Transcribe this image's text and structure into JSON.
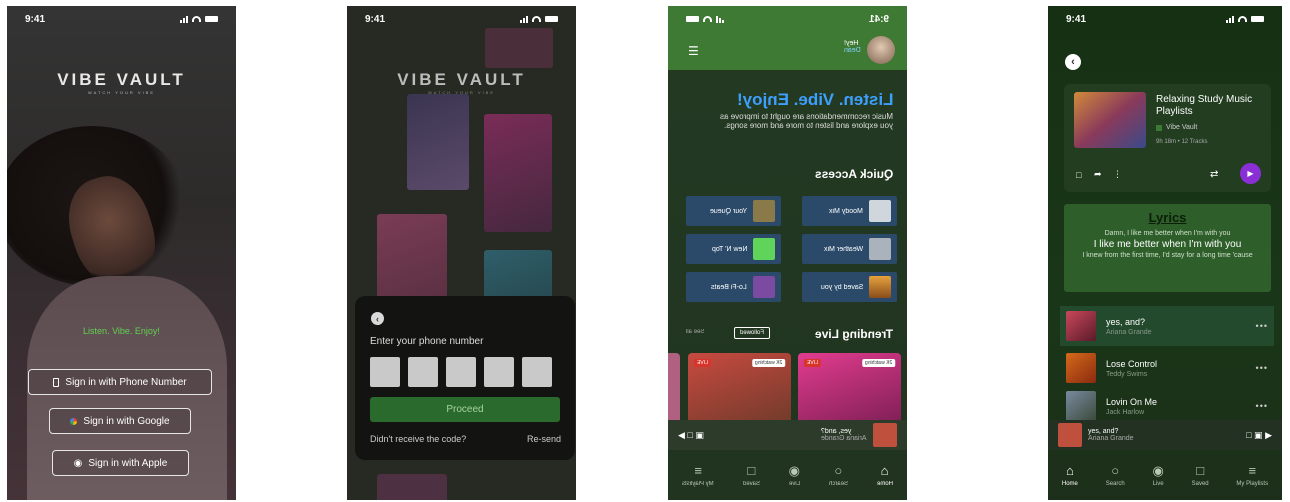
{
  "status": {
    "time": "9:41"
  },
  "screen1": {
    "brand": "VIBE VAULT",
    "brand_sub": "WATCH YOUR VIBE",
    "tagline": "Listen. Vibe. Enjoy!",
    "phone_btn": "Sign in with Phone Number",
    "google_btn": "Sign in with Google",
    "apple_btn": "Sign in with Apple"
  },
  "screen2": {
    "brand": "VIBE VAULT",
    "brand_sub": "WATCH YOUR VIBE",
    "prompt": "Enter your phone number",
    "proceed": "Proceed",
    "no_code": "Didn't receive the code?",
    "resend": "Re-send"
  },
  "screen3": {
    "status_time": "9:41",
    "greeting": "Hey!",
    "user": "Dean",
    "headline": "Listen. Vibe. Enjoy!",
    "intro": "Music recommendations are ought to improve as you explore and listen to more and more songs.",
    "quick_access": "Quick Access",
    "tiles": [
      "Moody Mix",
      "Your Queue",
      "Weather Mix",
      "New N' Top",
      "Saved by you",
      "Lo-Fi Beats"
    ],
    "trending": "Trending Live",
    "followed": "Followed",
    "see_all": "See all",
    "live": "LIVE",
    "watching": "2K watching",
    "mini_title": "yes, and?",
    "mini_artist": "Ariana Grande",
    "tabs": [
      "Home",
      "Search",
      "Live",
      "Saved",
      "My Playlists"
    ]
  },
  "screen4": {
    "playlist_title": "Relaxing Study Music Playlists",
    "owner": "Vibe Vault",
    "info": "9h 18m • 12 Tracks",
    "lyrics_title": "Lyrics",
    "lyric_1": "Damn, I like me better when I'm with you",
    "lyric_2": "I like me better when I'm with you",
    "lyric_3": "I knew from the first time, I'd stay for a long time 'cause",
    "songs": [
      {
        "title": "yes, and?",
        "artist": "Ariana Grande"
      },
      {
        "title": "Lose Control",
        "artist": "Teddy Swims"
      },
      {
        "title": "Lovin On Me",
        "artist": "Jack Harlow"
      }
    ],
    "mini_title": "yes, and?",
    "mini_artist": "Ariana Grande",
    "tabs": [
      "Home",
      "Search",
      "Live",
      "Saved",
      "My Playlists"
    ]
  },
  "colors": {
    "accent_green": "#62d14f",
    "header_green": "#3f7a34",
    "play_purple": "#8a2fd6"
  }
}
